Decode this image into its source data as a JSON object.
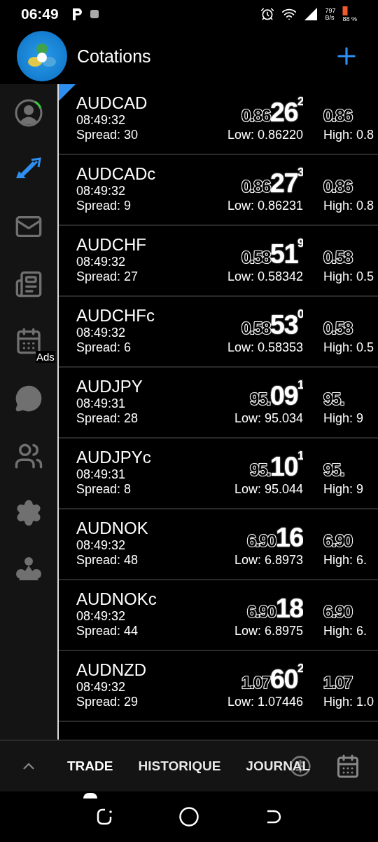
{
  "status_bar": {
    "time": "06:49",
    "speed_value": "797",
    "speed_unit": "B/s",
    "battery": "88 %"
  },
  "header": {
    "title": "Cotations"
  },
  "sidebar": {
    "items": [
      {
        "kind": "account",
        "selected": false
      },
      {
        "kind": "trade",
        "selected": true
      },
      {
        "kind": "mail",
        "selected": false
      },
      {
        "kind": "news",
        "selected": false
      },
      {
        "kind": "calendar",
        "selected": false,
        "badge": "Ads"
      },
      {
        "kind": "chat",
        "selected": false
      },
      {
        "kind": "community",
        "selected": false
      },
      {
        "kind": "settings",
        "selected": false
      },
      {
        "kind": "traders",
        "selected": false
      }
    ]
  },
  "quotes": [
    {
      "symbol": "AUDCAD",
      "time": "08:49:32",
      "spread": "Spread: 30",
      "bid": {
        "prefix": "0.86",
        "big": "26",
        "sup": "2"
      },
      "low": "Low: 0.86220",
      "ask": "0.86",
      "high": "High: 0.8"
    },
    {
      "symbol": "AUDCADc",
      "time": "08:49:32",
      "spread": "Spread: 9",
      "bid": {
        "prefix": "0.86",
        "big": "27",
        "sup": "3"
      },
      "low": "Low: 0.86231",
      "ask": "0.86",
      "high": "High: 0.8"
    },
    {
      "symbol": "AUDCHF",
      "time": "08:49:32",
      "spread": "Spread: 27",
      "bid": {
        "prefix": "0.58",
        "big": "51",
        "sup": "9"
      },
      "low": "Low: 0.58342",
      "ask": "0.58",
      "high": "High: 0.5"
    },
    {
      "symbol": "AUDCHFc",
      "time": "08:49:32",
      "spread": "Spread: 6",
      "bid": {
        "prefix": "0.58",
        "big": "53",
        "sup": "0"
      },
      "low": "Low: 0.58353",
      "ask": "0.58",
      "high": "High: 0.5"
    },
    {
      "symbol": "AUDJPY",
      "time": "08:49:31",
      "spread": "Spread: 28",
      "bid": {
        "prefix": "95.",
        "big": "09",
        "sup": "1"
      },
      "low": "Low: 95.034",
      "ask": "95.",
      "high": "High: 9"
    },
    {
      "symbol": "AUDJPYc",
      "time": "08:49:31",
      "spread": "Spread: 8",
      "bid": {
        "prefix": "95.",
        "big": "10",
        "sup": "1"
      },
      "low": "Low: 95.044",
      "ask": "95.",
      "high": "High: 9"
    },
    {
      "symbol": "AUDNOK",
      "time": "08:49:32",
      "spread": "Spread: 48",
      "bid": {
        "prefix": "6.90",
        "big": "16"
      },
      "low": "Low: 6.8973",
      "ask": "6.90",
      "high": "High: 6."
    },
    {
      "symbol": "AUDNOKc",
      "time": "08:49:32",
      "spread": "Spread: 44",
      "bid": {
        "prefix": "6.90",
        "big": "18"
      },
      "low": "Low: 6.8975",
      "ask": "6.90",
      "high": "High: 6."
    },
    {
      "symbol": "AUDNZD",
      "time": "08:49:32",
      "spread": "Spread: 29",
      "bid": {
        "prefix": "1.07",
        "big": "60",
        "sup": "2"
      },
      "low": "Low: 1.07446",
      "ask": "1.07",
      "high": "High: 1.0"
    }
  ],
  "bottom_tabs": [
    {
      "label": "TRADE",
      "selected": true
    },
    {
      "label": "HISTORIQUE",
      "selected": false
    },
    {
      "label": "JOURNAL",
      "selected": false
    }
  ]
}
